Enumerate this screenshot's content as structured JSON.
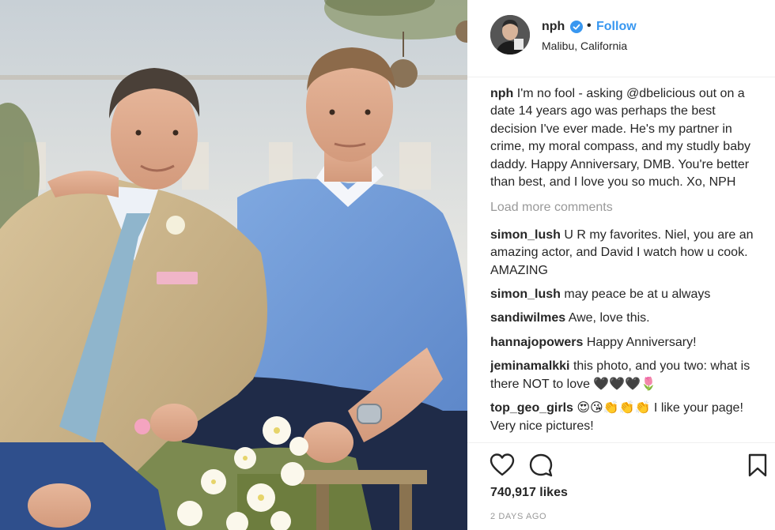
{
  "header": {
    "username": "nph",
    "dot": "•",
    "follow_label": "Follow",
    "location": "Malibu, California",
    "verified_icon": "verified-badge-icon",
    "avatar_icon": "profile-avatar"
  },
  "caption": {
    "user": "nph",
    "text": "I'm no fool - asking @dbelicious out on a date 14 years ago was perhaps the best decision I've ever made. He's my partner in crime, my moral compass, and my studly baby daddy. Happy Anniversary, DMB. You're better than best, and I love you so much. Xo, NPH"
  },
  "load_more": "Load more comments",
  "comments": [
    {
      "user": "simon_lush",
      "text": "U R my favorites. Niel, you are an amazing actor, and David I watch how u cook. AMAZING"
    },
    {
      "user": "simon_lush",
      "text": "may peace be at u always"
    },
    {
      "user": "sandiwilmes",
      "text": "Awe, love this."
    },
    {
      "user": "hannajopowers",
      "text": "Happy Anniversary!"
    },
    {
      "user": "jeminamalkki",
      "text": "this photo, and you two: what is there NOT to love 🖤🖤🖤🌷"
    },
    {
      "user": "top_geo_girls",
      "text": "😍😘👏👏👏 I like your page! Very nice pictures!"
    }
  ],
  "actions": {
    "like_icon": "heart-icon",
    "comment_icon": "comment-bubble-icon",
    "save_icon": "bookmark-icon",
    "likes": "740,917 likes",
    "timestamp": "2 DAYS AGO"
  },
  "colors": {
    "accent": "#3897f0",
    "text": "#262626",
    "muted": "#999999",
    "border": "#efefef"
  }
}
